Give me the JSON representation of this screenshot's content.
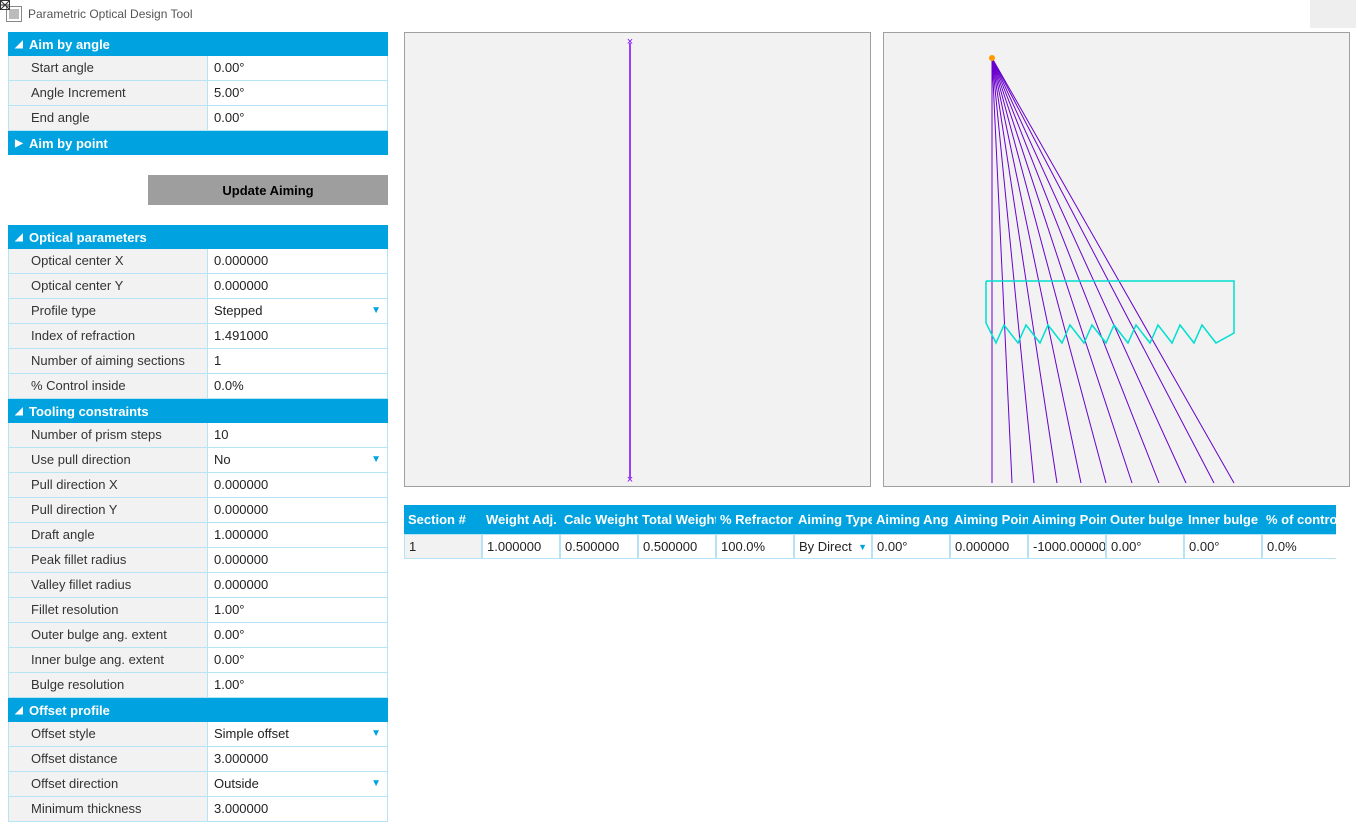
{
  "window": {
    "title": "Parametric Optical Design Tool"
  },
  "aim_angle": {
    "header": "Aim by angle",
    "rows": [
      {
        "label": "Start angle",
        "value": "0.00°"
      },
      {
        "label": "Angle Increment",
        "value": "5.00°"
      },
      {
        "label": "End angle",
        "value": "0.00°"
      }
    ]
  },
  "aim_point": {
    "header": "Aim by point"
  },
  "update_btn": "Update Aiming",
  "optical": {
    "header": "Optical parameters",
    "rows": [
      {
        "label": "Optical center X",
        "value": "0.000000"
      },
      {
        "label": "Optical center Y",
        "value": "0.000000"
      },
      {
        "label": "Profile type",
        "value": "Stepped",
        "dd": true
      },
      {
        "label": "Index of refraction",
        "value": "1.491000"
      },
      {
        "label": "Number of aiming sections",
        "value": "1"
      },
      {
        "label": "% Control inside",
        "value": "0.0%"
      }
    ]
  },
  "tooling": {
    "header": "Tooling constraints",
    "rows": [
      {
        "label": "Number of prism steps",
        "value": "10"
      },
      {
        "label": "Use pull direction",
        "value": "No",
        "dd": true
      },
      {
        "label": "Pull direction X",
        "value": "0.000000"
      },
      {
        "label": "Pull direction Y",
        "value": "0.000000"
      },
      {
        "label": "Draft angle",
        "value": "1.000000"
      },
      {
        "label": "Peak fillet radius",
        "value": "0.000000"
      },
      {
        "label": "Valley fillet radius",
        "value": "0.000000"
      },
      {
        "label": "Fillet resolution",
        "value": "1.00°"
      },
      {
        "label": "Outer bulge ang. extent",
        "value": "0.00°"
      },
      {
        "label": "Inner bulge ang. extent",
        "value": "0.00°"
      },
      {
        "label": "Bulge resolution",
        "value": "1.00°"
      }
    ]
  },
  "offset": {
    "header": "Offset profile",
    "rows": [
      {
        "label": "Offset style",
        "value": "Simple offset",
        "dd": true
      },
      {
        "label": "Offset distance",
        "value": "3.000000"
      },
      {
        "label": "Offset direction",
        "value": "Outside",
        "dd": true
      },
      {
        "label": "Minimum thickness",
        "value": "3.000000"
      }
    ]
  },
  "table": {
    "headers": [
      "Section #",
      "Weight Adj.",
      "Calc Weight",
      "Total Weight",
      "% Refractor",
      "Aiming Type",
      "Aiming Ang",
      "Aiming Point",
      "Aiming Point",
      "Outer bulge",
      "Inner bulge",
      "% of control"
    ],
    "row": [
      "1",
      "1.000000",
      "0.500000",
      "0.500000",
      "100.0%",
      "By Direct",
      "0.00°",
      "0.000000",
      "-1000.00000",
      "0.00°",
      "0.00°",
      "0.0%"
    ]
  }
}
